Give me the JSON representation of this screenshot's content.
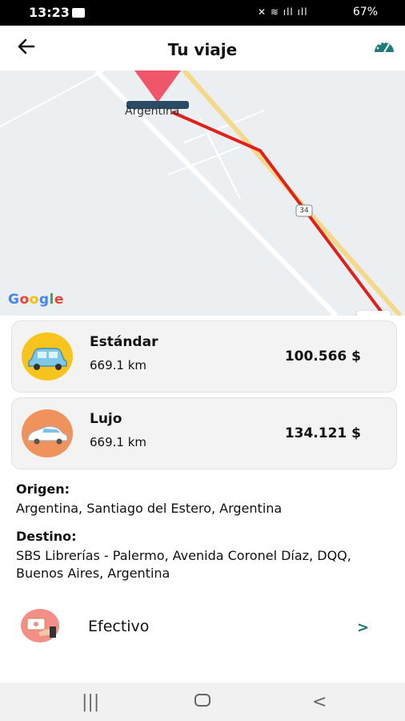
{
  "status_bar": {
    "time": "13:23",
    "battery": "67%",
    "icons": "✕ ≋ ıll ıll"
  },
  "header": {
    "title": "Tu viaje",
    "back_icon": "arrow-left-icon",
    "right_icon": "speedometer-icon"
  },
  "map": {
    "place_label": "Argentina",
    "route_shield": "34",
    "zoom_in": "+",
    "zoom_out": "−",
    "attribution": "Google",
    "colors": {
      "route": "#e0201b",
      "marker": "#f0566a",
      "highway": "#f4d98a"
    }
  },
  "rides": [
    {
      "name": "Estándar",
      "distance": "669.1 km",
      "price": "100.566 $",
      "icon": "car-icon",
      "color": "#f7c41d"
    },
    {
      "name": "Lujo",
      "distance": "669.1 km",
      "price": "134.121 $",
      "icon": "luxury-car-icon",
      "color": "#f0925b"
    }
  ],
  "origin": {
    "label": "Origen:",
    "value": "Argentina, Santiago del Estero, Argentina"
  },
  "destination": {
    "label": "Destino:",
    "value": "SBS Librerías - Palermo, Avenida Coronel Díaz, DQQ, Buenos Aires, Argentina"
  },
  "payment": {
    "method": "Efectivo",
    "icon": "cash-payment-icon"
  },
  "nav": {
    "recent": "|||",
    "home": "○",
    "back": "<"
  }
}
